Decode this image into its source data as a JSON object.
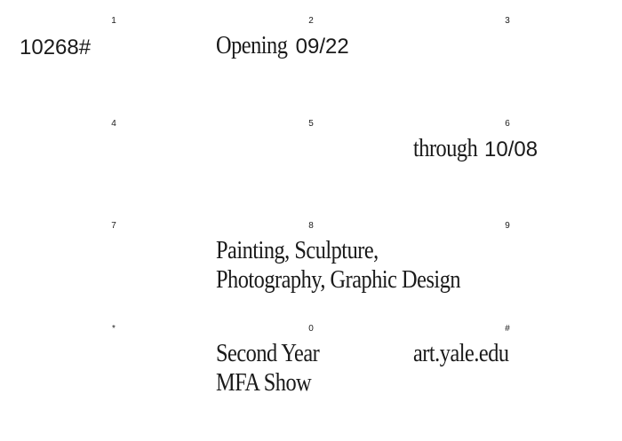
{
  "keypad": {
    "k1": "1",
    "k2": "2",
    "k3": "3",
    "k4": "4",
    "k5": "5",
    "k6": "6",
    "k7": "7",
    "k8": "8",
    "k9": "9",
    "kstar": "*",
    "k0": "0",
    "khash": "#"
  },
  "dial": {
    "number": "10268#"
  },
  "opening": {
    "word": "Opening",
    "date": "09/22"
  },
  "through": {
    "word": "through",
    "date": "10/08"
  },
  "disciplines": {
    "line1": "Painting, Sculpture,",
    "line2": "Photography, Graphic Design"
  },
  "show": {
    "line1": "Second Year",
    "line2": "MFA Show"
  },
  "website": {
    "url": "art.yale.edu"
  }
}
